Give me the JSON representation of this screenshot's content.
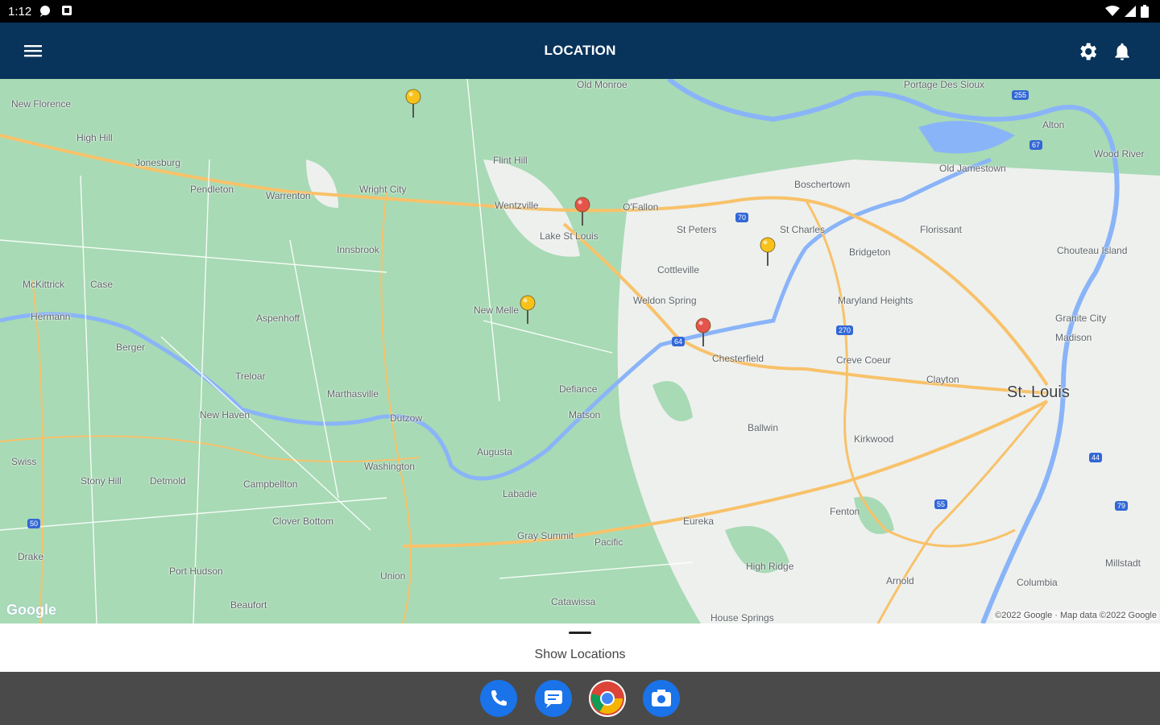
{
  "status_bar": {
    "time": "1:12"
  },
  "app_bar": {
    "title": "LOCATION"
  },
  "map": {
    "places": [
      {
        "name": "New Florence",
        "cls": ""
      },
      {
        "name": "High Hill",
        "cls": ""
      },
      {
        "name": "Jonesburg",
        "cls": ""
      },
      {
        "name": "Pendleton",
        "cls": ""
      },
      {
        "name": "Warrenton",
        "cls": ""
      },
      {
        "name": "Wright City",
        "cls": ""
      },
      {
        "name": "Flint Hill",
        "cls": ""
      },
      {
        "name": "Old Monroe",
        "cls": ""
      },
      {
        "name": "Portage Des Sioux",
        "cls": ""
      },
      {
        "name": "Alton",
        "cls": ""
      },
      {
        "name": "Wood River",
        "cls": ""
      },
      {
        "name": "Old Jamestown",
        "cls": ""
      },
      {
        "name": "Boschertown",
        "cls": ""
      },
      {
        "name": "Wentzville",
        "cls": ""
      },
      {
        "name": "O'Fallon",
        "cls": ""
      },
      {
        "name": "St Peters",
        "cls": ""
      },
      {
        "name": "St Charles",
        "cls": ""
      },
      {
        "name": "Florissant",
        "cls": ""
      },
      {
        "name": "Lake St Louis",
        "cls": ""
      },
      {
        "name": "Innsbrook",
        "cls": ""
      },
      {
        "name": "Bridgeton",
        "cls": ""
      },
      {
        "name": "Chouteau Island",
        "cls": ""
      },
      {
        "name": "Cottleville",
        "cls": ""
      },
      {
        "name": "McKittrick",
        "cls": ""
      },
      {
        "name": "Case",
        "cls": ""
      },
      {
        "name": "Maryland Heights",
        "cls": ""
      },
      {
        "name": "Hermann",
        "cls": ""
      },
      {
        "name": "Weldon Spring",
        "cls": ""
      },
      {
        "name": "New Melle",
        "cls": ""
      },
      {
        "name": "Aspenhoff",
        "cls": ""
      },
      {
        "name": "Granite City",
        "cls": ""
      },
      {
        "name": "Madison",
        "cls": ""
      },
      {
        "name": "Berger",
        "cls": ""
      },
      {
        "name": "Chesterfield",
        "cls": ""
      },
      {
        "name": "Creve Coeur",
        "cls": ""
      },
      {
        "name": "Treloar",
        "cls": ""
      },
      {
        "name": "Clayton",
        "cls": ""
      },
      {
        "name": "Defiance",
        "cls": ""
      },
      {
        "name": "Marthasville",
        "cls": ""
      },
      {
        "name": "St. Louis",
        "cls": "big"
      },
      {
        "name": "New Haven",
        "cls": ""
      },
      {
        "name": "Dutzow",
        "cls": ""
      },
      {
        "name": "Matson",
        "cls": ""
      },
      {
        "name": "Ballwin",
        "cls": ""
      },
      {
        "name": "Kirkwood",
        "cls": ""
      },
      {
        "name": "Augusta",
        "cls": ""
      },
      {
        "name": "Swiss",
        "cls": ""
      },
      {
        "name": "Washington",
        "cls": ""
      },
      {
        "name": "Stony Hill",
        "cls": ""
      },
      {
        "name": "Detmold",
        "cls": ""
      },
      {
        "name": "Campbellton",
        "cls": ""
      },
      {
        "name": "Labadie",
        "cls": ""
      },
      {
        "name": "Fenton",
        "cls": ""
      },
      {
        "name": "Clover Bottom",
        "cls": ""
      },
      {
        "name": "Eureka",
        "cls": ""
      },
      {
        "name": "Gray Summit",
        "cls": ""
      },
      {
        "name": "Pacific",
        "cls": ""
      },
      {
        "name": "Drake",
        "cls": ""
      },
      {
        "name": "Millstadt",
        "cls": ""
      },
      {
        "name": "High Ridge",
        "cls": ""
      },
      {
        "name": "Port Hudson",
        "cls": ""
      },
      {
        "name": "Arnold",
        "cls": ""
      },
      {
        "name": "Columbia",
        "cls": ""
      },
      {
        "name": "Union",
        "cls": ""
      },
      {
        "name": "Beaufort",
        "cls": ""
      },
      {
        "name": "Catawissa",
        "cls": ""
      },
      {
        "name": "House Springs",
        "cls": ""
      }
    ],
    "route_shields": [
      "70",
      "64",
      "270",
      "55",
      "44",
      "255",
      "67",
      "79",
      "50"
    ],
    "logo": "Google",
    "attribution": "©2022 Google · Map data ©2022 Google",
    "colors": {
      "land": "#a8dab5",
      "urban": "#eef0ee",
      "water": "#8ab4f8",
      "road": "#f8c26a"
    },
    "markers": [
      {
        "color": "yellow"
      },
      {
        "color": "red"
      },
      {
        "color": "yellow"
      },
      {
        "color": "yellow"
      },
      {
        "color": "red"
      }
    ]
  },
  "sheet": {
    "label": "Show Locations"
  },
  "dock": {
    "apps": [
      "Phone",
      "Messages",
      "Chrome",
      "Camera"
    ]
  }
}
